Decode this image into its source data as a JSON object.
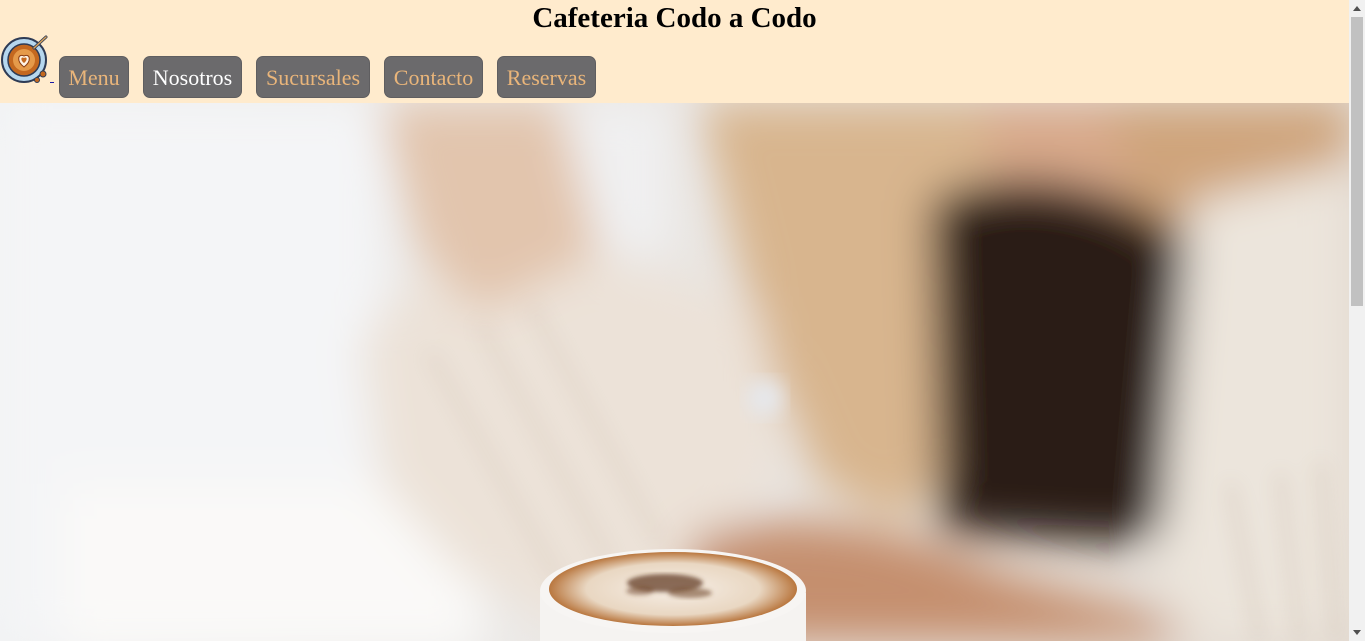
{
  "header": {
    "title": "Cafeteria Codo a Codo",
    "logo_icon": "coffee-cup-latte-art-icon"
  },
  "nav": {
    "items": [
      {
        "label": "Menu",
        "active": false
      },
      {
        "label": "Nosotros",
        "active": true
      },
      {
        "label": "Sucursales",
        "active": false
      },
      {
        "label": "Contacto",
        "active": false
      },
      {
        "label": "Reservas",
        "active": false
      }
    ]
  },
  "colors": {
    "header_bg": "#ffebcd",
    "nav_button_bg": "#6b6a6c",
    "nav_text": "#e9b57a",
    "nav_active_text": "#ffffff"
  },
  "hero": {
    "image": "woman-holding-cappuccino-photo"
  },
  "scrollbar": {
    "up_icon": "scroll-up-arrow-icon",
    "down_icon": "scroll-down-arrow-icon"
  }
}
